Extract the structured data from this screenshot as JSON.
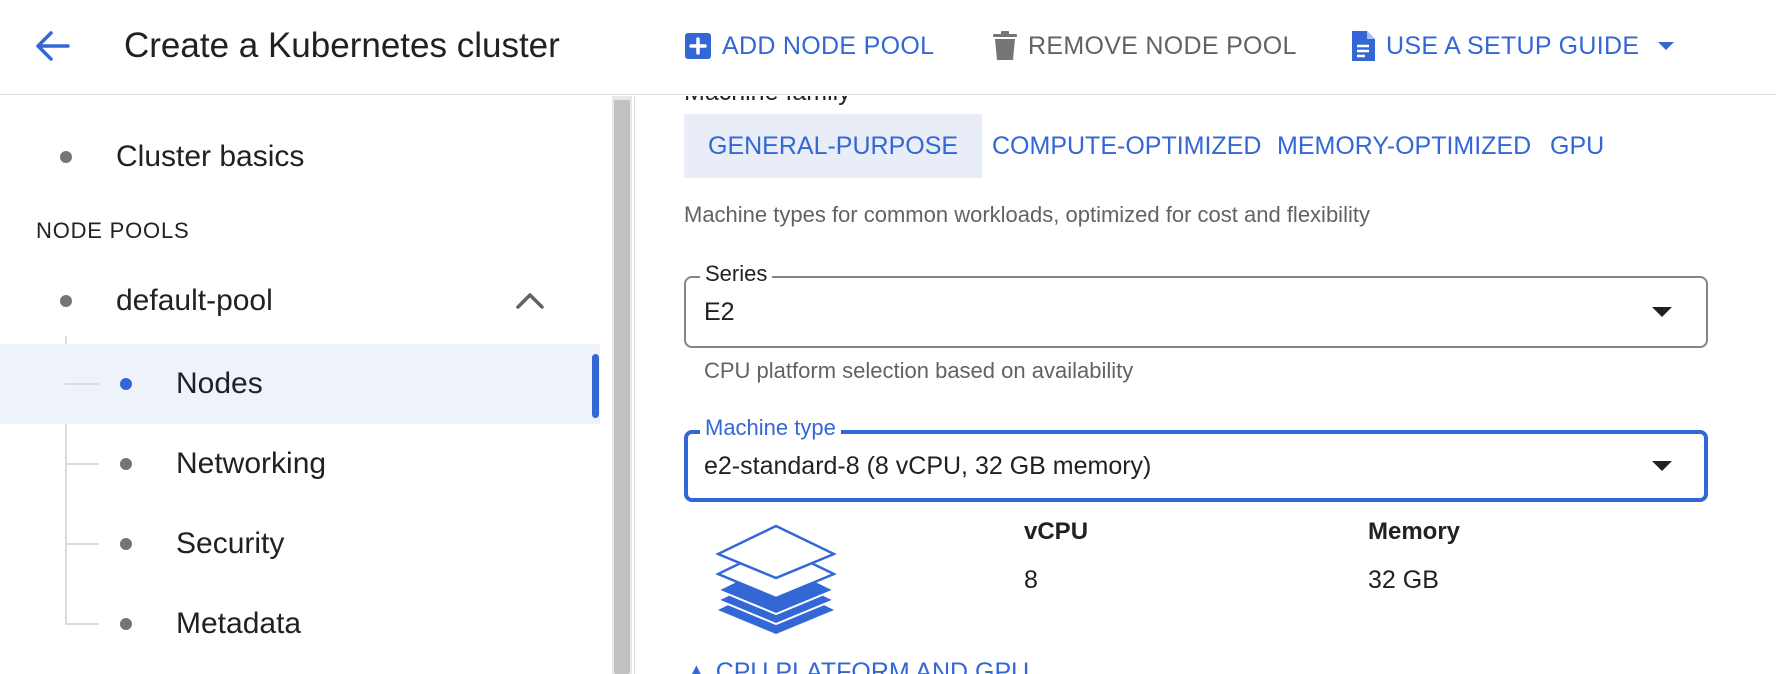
{
  "header": {
    "title": "Create a Kubernetes cluster",
    "add_node_pool": "ADD NODE POOL",
    "remove_node_pool": "REMOVE NODE POOL",
    "setup_guide": "USE A SETUP GUIDE"
  },
  "sidebar": {
    "cluster_basics": "Cluster basics",
    "node_pools_header": "NODE POOLS",
    "pool_name": "default-pool",
    "children": [
      "Nodes",
      "Networking",
      "Security",
      "Metadata"
    ],
    "selected": "Nodes"
  },
  "main": {
    "family_heading": "Machine family",
    "family_tabs": [
      "GENERAL-PURPOSE",
      "COMPUTE-OPTIMIZED",
      "MEMORY-OPTIMIZED",
      "GPU"
    ],
    "selected_family": "GENERAL-PURPOSE",
    "family_description": "Machine types for common workloads, optimized for cost and flexibility",
    "series": {
      "label": "Series",
      "value": "E2",
      "helper": "CPU platform selection based on availability"
    },
    "machine_type": {
      "label": "Machine type",
      "value": "e2-standard-8 (8 vCPU, 32 GB memory)"
    },
    "specs": {
      "vcpu_label": "vCPU",
      "vcpu_value": "8",
      "memory_label": "Memory",
      "memory_value": "32 GB"
    },
    "cpu_platform_link": "CPU PLATFORM AND GPU"
  },
  "colors": {
    "accent": "#3367d6",
    "selected_bg": "#eef2fb",
    "muted_text": "#5f6368"
  },
  "icons": {
    "back": "arrow-back-icon",
    "add": "add-box-icon",
    "delete": "delete-icon",
    "guide": "document-icon",
    "machine": "stacked-layers-icon"
  }
}
